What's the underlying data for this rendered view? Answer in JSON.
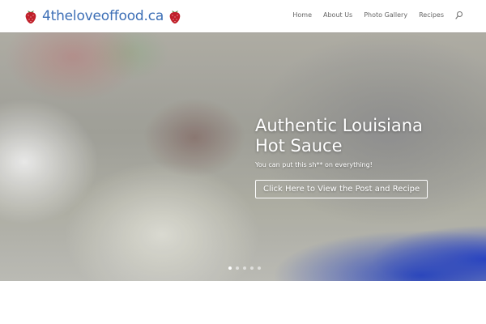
{
  "header": {
    "logo_text": "4theloveoffood.ca",
    "nav": [
      {
        "label": "Home"
      },
      {
        "label": "About Us"
      },
      {
        "label": "Photo Gallery"
      },
      {
        "label": "Recipes"
      }
    ]
  },
  "hero": {
    "title_line1": "Authentic Louisiana",
    "title_line2": "Hot Sauce",
    "subtitle": "You can put this sh** on everything!",
    "button_label": "Click Here to View the Post and Recipe",
    "slide_count": 5,
    "active_slide": 1
  },
  "colors": {
    "brand_blue": "#3d6fb6",
    "berry_red": "#c0202a",
    "nav_text": "#666666"
  },
  "icons": {
    "logo_left": "strawberry-icon",
    "logo_right": "strawberry-icon",
    "search": "search-icon"
  }
}
